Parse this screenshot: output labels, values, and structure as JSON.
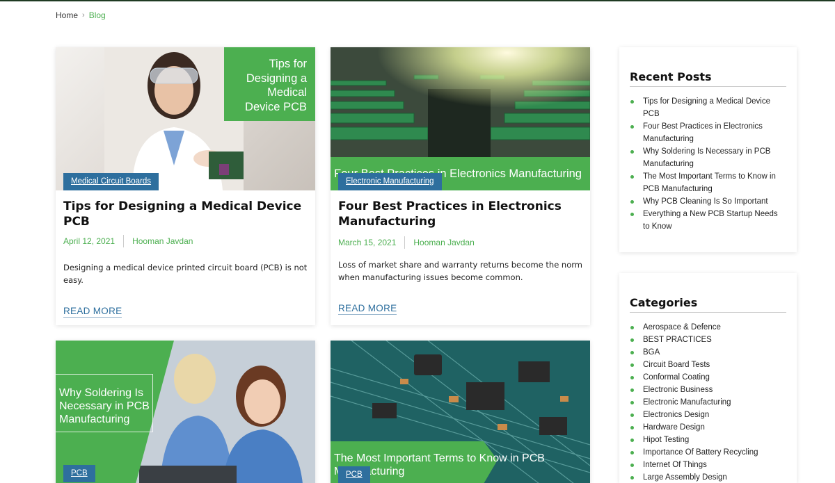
{
  "breadcrumb": {
    "home": "Home",
    "current": "Blog"
  },
  "posts": [
    {
      "badge": "Medical Circuit Boards",
      "image_text": [
        "Tips for",
        "Designing a",
        "Medical",
        "Device PCB"
      ],
      "title": "Tips for Designing a Medical Device PCB",
      "date": "April 12, 2021",
      "author": "Hooman Javdan",
      "excerpt": "Designing a medical device printed circuit board (PCB) is not easy.",
      "read_more": "READ MORE"
    },
    {
      "badge": "Electronic Manufacturing",
      "image_text": "Four Best Practices in Electronics Manufacturing",
      "title": "Four Best Practices in Electronics Manufacturing",
      "date": "March 15, 2021",
      "author": "Hooman Javdan",
      "excerpt": "Loss of market share and warranty returns become the norm when manufacturing issues become common.",
      "read_more": "READ MORE"
    },
    {
      "badge": "PCB",
      "image_text": "Why Soldering Is Necessary in PCB Manufacturing"
    },
    {
      "badge": "PCB",
      "image_text": "The Most Important Terms to Know in PCB Manufacturing"
    }
  ],
  "sidebar": {
    "recent_posts": {
      "title": "Recent Posts",
      "items": [
        "Tips for Designing a Medical Device PCB",
        "Four Best Practices in Electronics Manufacturing",
        "Why Soldering Is Necessary in PCB Manufacturing",
        "The Most Important Terms to Know in PCB Manufacturing",
        "Why PCB Cleaning Is So Important",
        "Everything a New PCB Startup Needs to Know"
      ]
    },
    "categories": {
      "title": "Categories",
      "items": [
        "Aerospace & Defence",
        "BEST PRACTICES",
        "BGA",
        "Circuit Board Tests",
        "Conformal Coating",
        "Electronic Business",
        "Electronic Manufacturing",
        "Electronics Design",
        "Hardware Design",
        "Hipot Testing",
        "Importance Of Battery Recycling",
        "Internet Of Things",
        "Large Assembly Design"
      ]
    }
  },
  "colors": {
    "accent_green": "#4caf50",
    "badge_blue": "#2e6f9e",
    "link_blue": "#2e6f9e"
  }
}
